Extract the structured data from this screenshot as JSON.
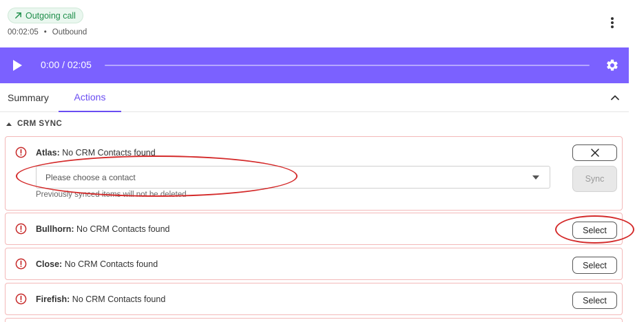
{
  "call": {
    "badge_label": "Outgoing call",
    "duration": "00:02:05",
    "separator": "•",
    "direction": "Outbound"
  },
  "player": {
    "time_display": "0:00 / 02:05",
    "progress_fraction": 0.0
  },
  "tabs": [
    {
      "label": "Summary",
      "active": false
    },
    {
      "label": "Actions",
      "active": true
    }
  ],
  "section": {
    "title": "CRM SYNC"
  },
  "crm_items": [
    {
      "name": "Atlas",
      "status": " No CRM Contacts found",
      "contact_placeholder": "Please choose a contact",
      "hint": "Previously synced items will not be deleted",
      "sync_label": "Sync"
    },
    {
      "name": "Bullhorn",
      "status": " No CRM Contacts found",
      "action_label": "Select"
    },
    {
      "name": "Close",
      "status": " No CRM Contacts found",
      "action_label": "Select"
    },
    {
      "name": "Firefish",
      "status": " No CRM Contacts found",
      "action_label": "Select"
    }
  ],
  "colors": {
    "player_bg": "#7b61ff",
    "accent": "#6a4df2",
    "badge_green": "#1e8e4a",
    "error_red": "#d42a2a",
    "card_border": "#f3b8b8"
  },
  "icons": {
    "badge": "arrow-up-right-icon",
    "menu": "kebab-menu-icon",
    "play": "play-icon",
    "settings": "gear-icon",
    "collapse": "chevron-up-icon",
    "warning": "exclamation-circle-icon",
    "close": "close-icon"
  }
}
